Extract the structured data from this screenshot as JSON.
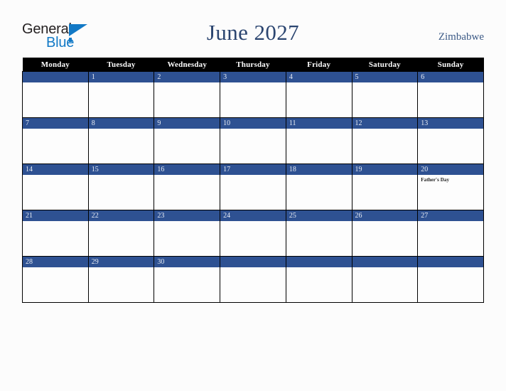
{
  "brand": {
    "name_part1": "General",
    "name_part2": "Blue",
    "accent_color": "#1279c6",
    "triangle_icon": "triangle-icon"
  },
  "header": {
    "title": "June 2027",
    "country": "Zimbabwe",
    "title_color": "#2b4570",
    "country_color": "#3c5a86"
  },
  "calendar": {
    "month": "June",
    "year": "2027",
    "header_bg": "#000000",
    "daynum_bg": "#2e5192",
    "weekdays": [
      "Monday",
      "Tuesday",
      "Wednesday",
      "Thursday",
      "Friday",
      "Saturday",
      "Sunday"
    ],
    "weeks": [
      [
        {
          "day": "",
          "event": ""
        },
        {
          "day": "1",
          "event": ""
        },
        {
          "day": "2",
          "event": ""
        },
        {
          "day": "3",
          "event": ""
        },
        {
          "day": "4",
          "event": ""
        },
        {
          "day": "5",
          "event": ""
        },
        {
          "day": "6",
          "event": ""
        }
      ],
      [
        {
          "day": "7",
          "event": ""
        },
        {
          "day": "8",
          "event": ""
        },
        {
          "day": "9",
          "event": ""
        },
        {
          "day": "10",
          "event": ""
        },
        {
          "day": "11",
          "event": ""
        },
        {
          "day": "12",
          "event": ""
        },
        {
          "day": "13",
          "event": ""
        }
      ],
      [
        {
          "day": "14",
          "event": ""
        },
        {
          "day": "15",
          "event": ""
        },
        {
          "day": "16",
          "event": ""
        },
        {
          "day": "17",
          "event": ""
        },
        {
          "day": "18",
          "event": ""
        },
        {
          "day": "19",
          "event": ""
        },
        {
          "day": "20",
          "event": "Father's Day"
        }
      ],
      [
        {
          "day": "21",
          "event": ""
        },
        {
          "day": "22",
          "event": ""
        },
        {
          "day": "23",
          "event": ""
        },
        {
          "day": "24",
          "event": ""
        },
        {
          "day": "25",
          "event": ""
        },
        {
          "day": "26",
          "event": ""
        },
        {
          "day": "27",
          "event": ""
        }
      ],
      [
        {
          "day": "28",
          "event": ""
        },
        {
          "day": "29",
          "event": ""
        },
        {
          "day": "30",
          "event": ""
        },
        {
          "day": "",
          "event": ""
        },
        {
          "day": "",
          "event": ""
        },
        {
          "day": "",
          "event": ""
        },
        {
          "day": "",
          "event": ""
        }
      ]
    ]
  }
}
